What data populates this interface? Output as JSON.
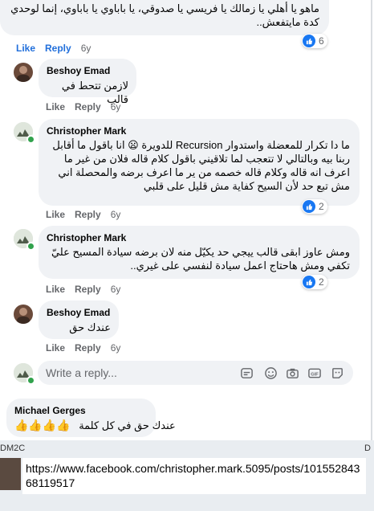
{
  "top_comment": {
    "text": "ماهو يا أهلي يا زمالك يا فريسي يا صدوقي، يا باباوي يا باباوي، إنما لوحدي كدة مايتفعش..",
    "actions": {
      "like": "Like",
      "reply": "Reply",
      "time": "6y"
    },
    "reaction_count": "6"
  },
  "comments": [
    {
      "author": "Beshoy Emad",
      "text": "لازمن تتحط في قالب",
      "actions": {
        "like": "Like",
        "reply": "Reply",
        "time": "6y"
      }
    },
    {
      "author": "Christopher Mark",
      "text": "ما دا تكرار للمعضلة واستدوار Recursion للدويرة 😦 انا باقول ما أقابل ربنا بيه وبالتالي لا تتعجب لما تلاقيني باقول كلام قاله فلان من غير ما اعرف انه قاله وكلام قاله خصمه من ير ما اعرف برضه والمحصلة اني مش تبع حد لأن السيح كفاية مش قليل على قلبي",
      "actions": {
        "like": "Like",
        "reply": "Reply",
        "time": "6y"
      },
      "reaction_count": "2"
    },
    {
      "author": "Christopher Mark",
      "text": "ومش عاوز ابقى قالب ييجي حد يكيّل منه لان برضه سيادة المسيح عليّ تكفي ومش هاحتاج اعمل سيادة لنفسي على غيري..",
      "actions": {
        "like": "Like",
        "reply": "Reply",
        "time": "6y"
      },
      "reaction_count": "2"
    },
    {
      "author": "Beshoy Emad",
      "text": "عندك حق",
      "actions": {
        "like": "Like",
        "reply": "Reply",
        "time": "6y"
      }
    }
  ],
  "reply_box": {
    "placeholder": "Write a reply..."
  },
  "last_comment": {
    "author": "Michael Gerges",
    "text": "عندك حق في كل كلمة",
    "emoji": "👍👍👍👍"
  },
  "taskbar": {
    "label": "DM2C",
    "url": "https://www.facebook.com/christopher.mark.5095/posts/10155284368119517"
  },
  "colors": {
    "bubble": "#f0f2f5",
    "like_blue": "#1877f2",
    "link_blue": "#216fdb",
    "muted": "#65676b",
    "online": "#31a24c"
  },
  "icons": [
    "like-icon",
    "sticker-icon",
    "emoji-icon",
    "camera-icon",
    "gif-icon",
    "avatar-sticker-icon"
  ]
}
